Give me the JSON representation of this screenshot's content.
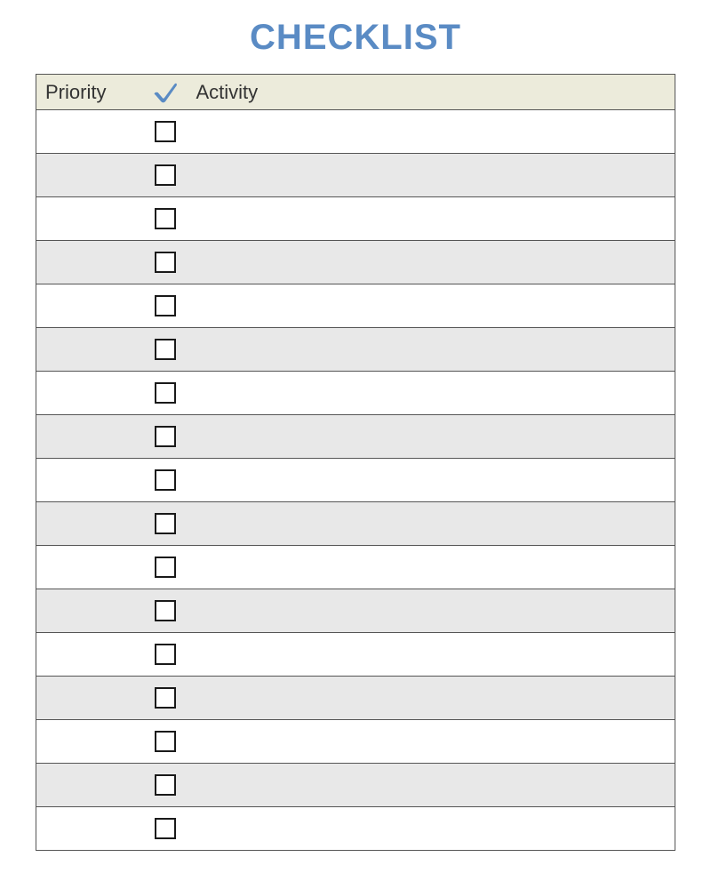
{
  "title": "CHECKLIST",
  "columns": {
    "priority": "Priority",
    "activity": "Activity"
  },
  "rows": [
    {
      "priority": "",
      "done": false,
      "activity": ""
    },
    {
      "priority": "",
      "done": false,
      "activity": ""
    },
    {
      "priority": "",
      "done": false,
      "activity": ""
    },
    {
      "priority": "",
      "done": false,
      "activity": ""
    },
    {
      "priority": "",
      "done": false,
      "activity": ""
    },
    {
      "priority": "",
      "done": false,
      "activity": ""
    },
    {
      "priority": "",
      "done": false,
      "activity": ""
    },
    {
      "priority": "",
      "done": false,
      "activity": ""
    },
    {
      "priority": "",
      "done": false,
      "activity": ""
    },
    {
      "priority": "",
      "done": false,
      "activity": ""
    },
    {
      "priority": "",
      "done": false,
      "activity": ""
    },
    {
      "priority": "",
      "done": false,
      "activity": ""
    },
    {
      "priority": "",
      "done": false,
      "activity": ""
    },
    {
      "priority": "",
      "done": false,
      "activity": ""
    },
    {
      "priority": "",
      "done": false,
      "activity": ""
    },
    {
      "priority": "",
      "done": false,
      "activity": ""
    },
    {
      "priority": "",
      "done": false,
      "activity": ""
    }
  ],
  "colors": {
    "accent": "#5a8bc4",
    "header_bg": "#ecebdb",
    "alt_row_bg": "#e8e8e8"
  }
}
